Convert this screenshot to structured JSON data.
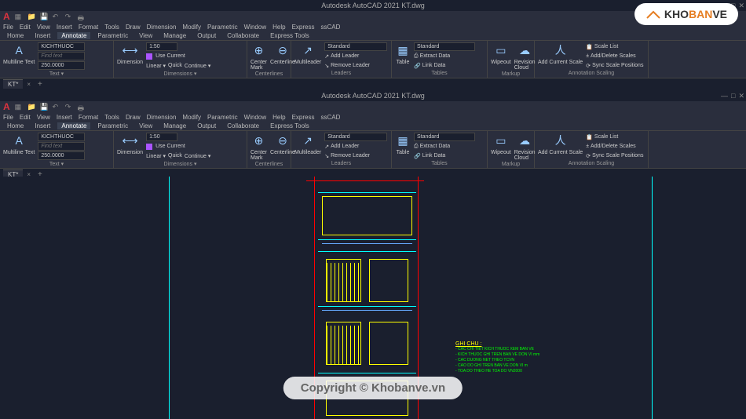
{
  "app": {
    "title": "Autodesk AutoCAD 2021   KT.dwg"
  },
  "menu": [
    "File",
    "Edit",
    "View",
    "Insert",
    "Format",
    "Tools",
    "Draw",
    "Dimension",
    "Modify",
    "Parametric",
    "Window",
    "Help",
    "Express",
    "ssCAD"
  ],
  "tabs": [
    "Home",
    "Insert",
    "Annotate",
    "Parametric",
    "View",
    "Manage",
    "Output",
    "Collaborate",
    "Express Tools"
  ],
  "activeTab": "Annotate",
  "ribbon": {
    "text": {
      "btn": "Multiline Text",
      "style": "KICHTHUOC",
      "find": "Find text",
      "height": "250.0000",
      "title": "Text ▾"
    },
    "dim": {
      "btn": "Dimension",
      "scale": "1:50",
      "use": "Use Current",
      "linear": "Linear ▾",
      "quick": "Quick",
      "cont": "Continue ▾",
      "title": "Dimensions ▾"
    },
    "center": {
      "b1": "Center Mark",
      "b2": "Centerline",
      "title": "Centerlines"
    },
    "leader": {
      "btn": "Multileader",
      "style": "Standard",
      "add": "Add Leader",
      "rem": "Remove Leader",
      "title": "Leaders"
    },
    "table": {
      "btn": "Table",
      "style": "Standard",
      "ext": "Extract Data",
      "link": "Link Data",
      "title": "Tables"
    },
    "markup": {
      "b1": "Wipeout",
      "b2": "Revision Cloud",
      "title": "Markup"
    },
    "scaling": {
      "b1": "Add Current Scale",
      "sl": "Scale List",
      "ad": "Add/Delete Scales",
      "sy": "Sync Scale Positions",
      "title": "Annotation Scaling"
    }
  },
  "doctab": "KT*",
  "notes": {
    "title": "GHI CHU :",
    "lines": [
      "- CAC CHI TIET KICH THUOC XEM BAN VE",
      "- KICH THUOC GHI TREN BAN VE DON VI mm",
      "- CAC DUONG NET THEO TCVN",
      "- CAO DO GHI TREN BAN VE DON VI m",
      "- TOA DO THEO HE TOA DO VN2000"
    ]
  },
  "watermark": "Copyright © Khobanve.vn",
  "brand": {
    "t1": "KHO",
    "t2": "BAN",
    "t3": "VE"
  }
}
